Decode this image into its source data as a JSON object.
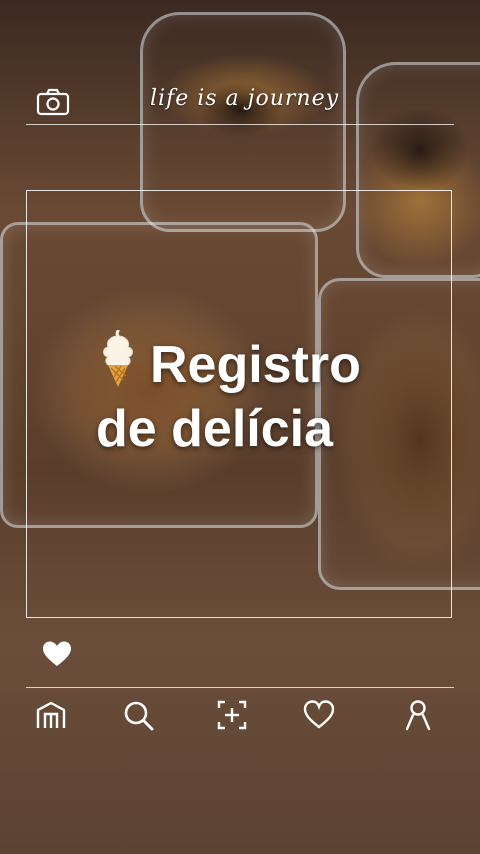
{
  "header": {
    "title": "life is a journey",
    "camera_icon": "camera-icon"
  },
  "post": {
    "emoji_icon": "soft-serve-ice-cream-icon",
    "headline_line1": "Registro",
    "headline_line2": "de delícia",
    "like_icon": "heart-icon"
  },
  "nav": {
    "items": [
      "home-icon",
      "search-icon",
      "add-post-icon",
      "heart-outline-icon",
      "profile-icon"
    ]
  },
  "colors": {
    "text": "#ffffff",
    "lines": "#ffffff"
  }
}
